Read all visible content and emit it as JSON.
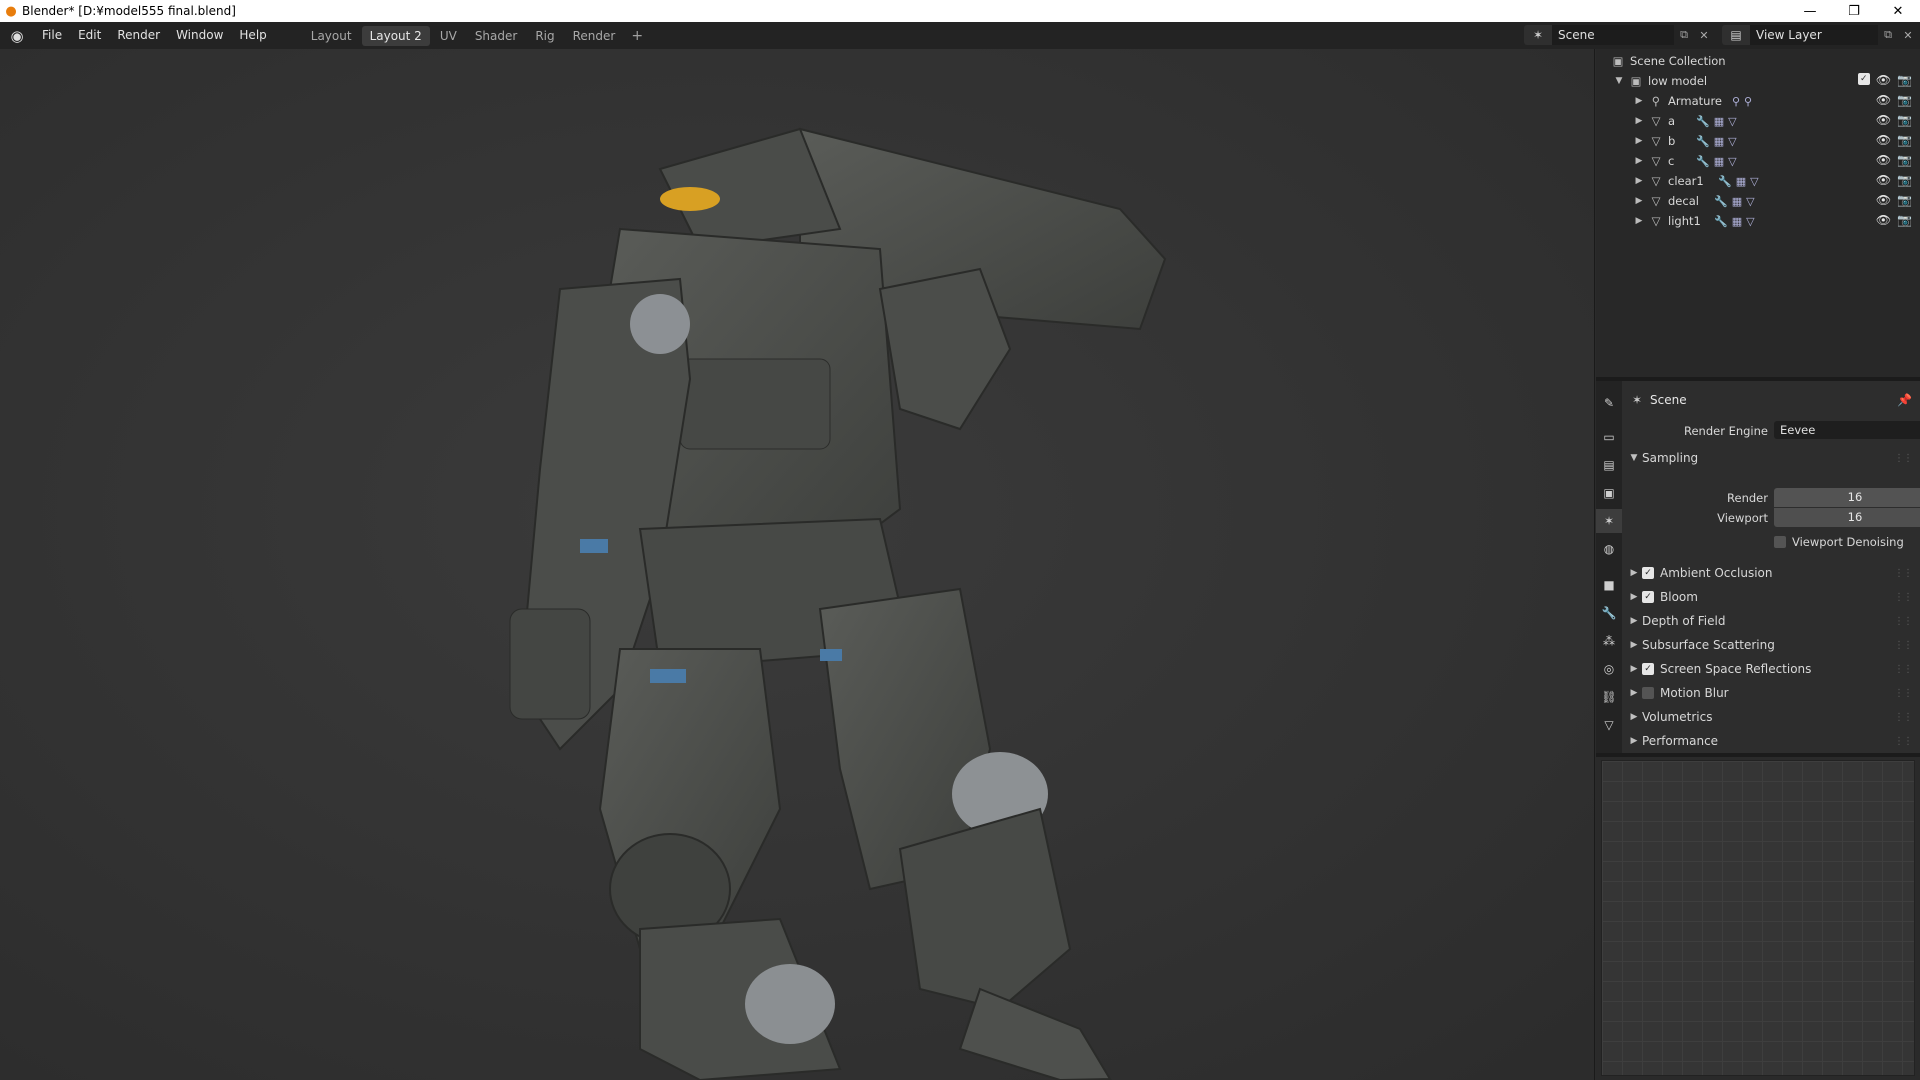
{
  "window": {
    "title": "Blender* [D:¥model555 final.blend]",
    "app_icon": "blender-logo-icon",
    "controls": [
      "minimize-icon",
      "restore-icon",
      "close-icon"
    ]
  },
  "menu": {
    "items": [
      "File",
      "Edit",
      "Render",
      "Window",
      "Help"
    ]
  },
  "workspaces": {
    "tabs": [
      "Layout",
      "Layout 2",
      "UV",
      "Shader",
      "Rig",
      "Render"
    ],
    "active": "Layout 2",
    "add": "+"
  },
  "scene_selector": {
    "value": "Scene"
  },
  "view_layer_selector": {
    "value": "View Layer"
  },
  "viewport": {
    "subject": "robot-mech-model"
  },
  "outliner": {
    "root": "Scene Collection",
    "collection": "low model",
    "objects": [
      {
        "name": "Armature",
        "type": "armature-icon"
      },
      {
        "name": "a",
        "type": "mesh-icon"
      },
      {
        "name": "b",
        "type": "mesh-icon"
      },
      {
        "name": "c",
        "type": "mesh-icon"
      },
      {
        "name": "clear1",
        "type": "mesh-icon"
      },
      {
        "name": "decal",
        "type": "mesh-icon"
      },
      {
        "name": "light1",
        "type": "mesh-icon"
      }
    ]
  },
  "properties": {
    "context": "Scene",
    "render_engine_label": "Render Engine",
    "render_engine": "Eevee",
    "sampling": {
      "title": "Sampling",
      "render_label": "Render",
      "render_value": "16",
      "viewport_label": "Viewport",
      "viewport_value": "16",
      "denoise_label": "Viewport Denoising",
      "denoise_checked": false
    },
    "sections": [
      {
        "label": "Ambient Occlusion",
        "checkbox": true,
        "checked": true
      },
      {
        "label": "Bloom",
        "checkbox": true,
        "checked": true
      },
      {
        "label": "Depth of Field",
        "checkbox": false
      },
      {
        "label": "Subsurface Scattering",
        "checkbox": false
      },
      {
        "label": "Screen Space Reflections",
        "checkbox": true,
        "checked": true
      },
      {
        "label": "Motion Blur",
        "checkbox": true,
        "checked": false
      },
      {
        "label": "Volumetrics",
        "checkbox": false
      },
      {
        "label": "Performance",
        "checkbox": false
      }
    ]
  },
  "colors": {
    "accent_orange": "#e87d0d",
    "panel_bg": "#2d2d2d",
    "viewport_bg": "#3a3a3a"
  }
}
